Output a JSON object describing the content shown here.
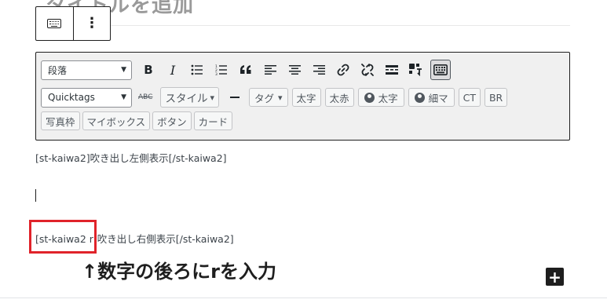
{
  "header": {
    "title_partial": "タイトルを追加"
  },
  "block_toolbar": {
    "keyboard_icon": "keyboard-icon",
    "more_icon": "more-vertical-icon",
    "more_glyph": "⋮"
  },
  "toolbar": {
    "format_select": "段落",
    "bold": "B",
    "italic": "I",
    "quickTags_select": "Quicktags",
    "strike_label": "ABC",
    "style_label": "スタイル",
    "style_caret": "▾",
    "tag_label": "タグ",
    "tag_caret": "▾",
    "caret_glyph": "▼",
    "buttons_row2": [
      "太字",
      "太赤"
    ],
    "user_bold": "太字",
    "user_small": "細マ",
    "ct": "CT",
    "br": "BR",
    "buttons_row3": [
      "写真枠",
      "マイボックス",
      "ボタン",
      "カード"
    ]
  },
  "content": {
    "line1": "[st-kaiwa2]吹き出し左側表示[/st-kaiwa2]",
    "line2": "[st-kaiwa2 r]吹き出し右側表示[/st-kaiwa2]"
  },
  "annotation": {
    "text": "↑数字の後ろにrを入力"
  },
  "add_block": {
    "glyph": "+"
  },
  "colors": {
    "highlight": "#e0232a",
    "toolbar_bg": "#f0f0f0",
    "dark": "#1e1e1e"
  }
}
